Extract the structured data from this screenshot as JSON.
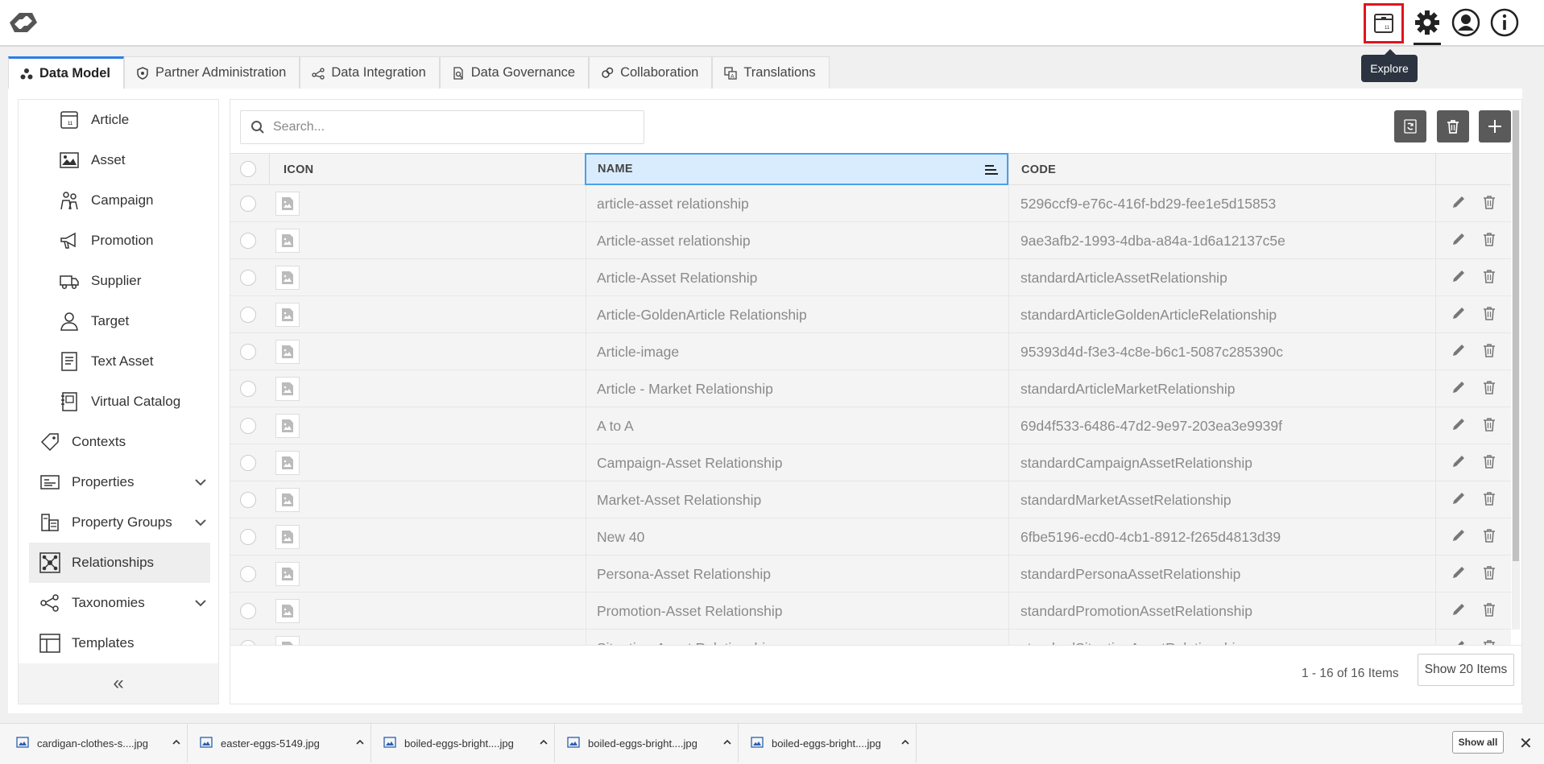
{
  "app": {
    "logo": "app-logo"
  },
  "header": {
    "explore_tooltip": "Explore"
  },
  "tabs": [
    {
      "label": "Data Model",
      "active": true
    },
    {
      "label": "Partner Administration"
    },
    {
      "label": "Data Integration"
    },
    {
      "label": "Data Governance"
    },
    {
      "label": "Collaboration"
    },
    {
      "label": "Translations"
    }
  ],
  "sidebar": {
    "items": [
      {
        "label": "Article",
        "icon": "article-icon"
      },
      {
        "label": "Asset",
        "icon": "image-icon"
      },
      {
        "label": "Campaign",
        "icon": "campaign-icon"
      },
      {
        "label": "Promotion",
        "icon": "megaphone-icon"
      },
      {
        "label": "Supplier",
        "icon": "truck-icon"
      },
      {
        "label": "Target",
        "icon": "person-icon"
      },
      {
        "label": "Text Asset",
        "icon": "document-icon"
      },
      {
        "label": "Virtual Catalog",
        "icon": "catalog-icon"
      },
      {
        "label": "Contexts",
        "icon": "tag-icon"
      },
      {
        "label": "Properties",
        "icon": "properties-icon",
        "expandable": true
      },
      {
        "label": "Property Groups",
        "icon": "property-groups-icon",
        "expandable": true
      },
      {
        "label": "Relationships",
        "icon": "relationships-icon",
        "active": true
      },
      {
        "label": "Taxonomies",
        "icon": "taxonomy-icon",
        "expandable": true
      },
      {
        "label": "Templates",
        "icon": "templates-icon"
      }
    ],
    "collapse_label": "«"
  },
  "grid": {
    "search_placeholder": "Search...",
    "columns": {
      "icon": "ICON",
      "name": "NAME",
      "code": "CODE"
    },
    "rows": [
      {
        "name": "article-asset relationship",
        "code": "5296ccf9-e76c-416f-bd29-fee1e5d15853"
      },
      {
        "name": "Article-asset relationship",
        "code": "9ae3afb2-1993-4dba-a84a-1d6a12137c5e"
      },
      {
        "name": "Article-Asset Relationship",
        "code": "standardArticleAssetRelationship"
      },
      {
        "name": "Article-GoldenArticle Relationship",
        "code": "standardArticleGoldenArticleRelationship"
      },
      {
        "name": "Article-image",
        "code": "95393d4d-f3e3-4c8e-b6c1-5087c285390c"
      },
      {
        "name": "Article - Market Relationship",
        "code": "standardArticleMarketRelationship"
      },
      {
        "name": "A to A",
        "code": "69d4f533-6486-47d2-9e97-203ea3e9939f"
      },
      {
        "name": "Campaign-Asset Relationship",
        "code": "standardCampaignAssetRelationship"
      },
      {
        "name": "Market-Asset Relationship",
        "code": "standardMarketAssetRelationship"
      },
      {
        "name": "New 40",
        "code": "6fbe5196-ecd0-4cb1-8912-f265d4813d39"
      },
      {
        "name": "Persona-Asset Relationship",
        "code": "standardPersonaAssetRelationship"
      },
      {
        "name": "Promotion-Asset Relationship",
        "code": "standardPromotionAssetRelationship"
      },
      {
        "name": "Situation-Asset Relationship",
        "code": "standardSituationAssetRelationship"
      }
    ],
    "pager_info": "1 - 16 of 16 Items",
    "page_size_label": "Show 20 Items"
  },
  "downloads": {
    "items": [
      {
        "label": "cardigan-clothes-s....jpg"
      },
      {
        "label": "easter-eggs-5149.jpg"
      },
      {
        "label": "boiled-eggs-bright....jpg"
      },
      {
        "label": "boiled-eggs-bright....jpg"
      },
      {
        "label": "boiled-eggs-bright....jpg"
      }
    ],
    "show_all_label": "Show all",
    "close_label": "✕"
  },
  "colors": {
    "accent": "#2b7de9",
    "highlight": "#e0141e",
    "header_selected": "#d9ecfd"
  }
}
